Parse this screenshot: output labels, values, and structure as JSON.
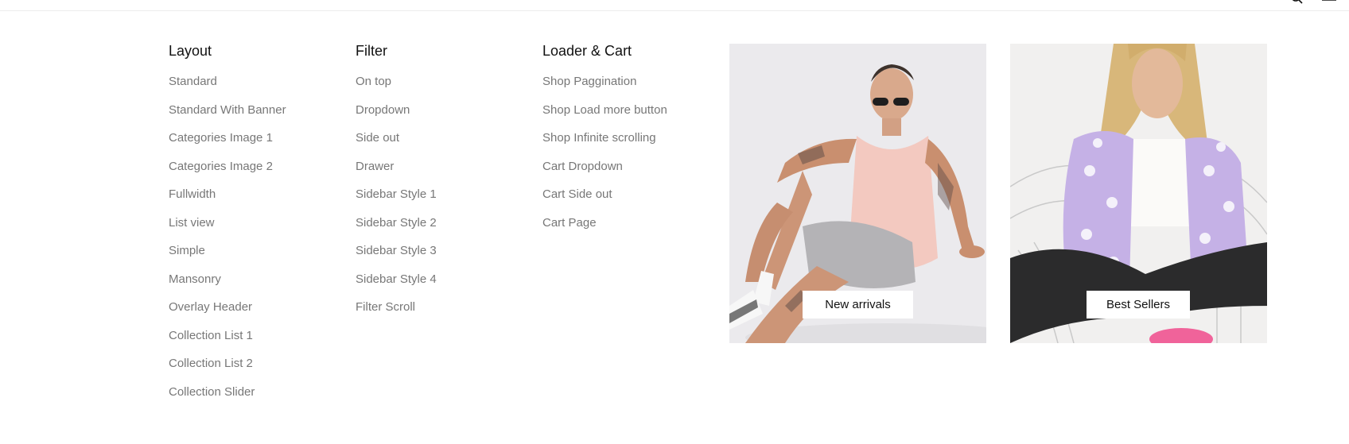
{
  "header": {
    "nav_stub": "",
    "icons": [
      "search-icon",
      "menu-icon"
    ]
  },
  "menu": {
    "layout": {
      "title": "Layout",
      "items": [
        "Standard",
        "Standard With Banner",
        "Categories Image 1",
        "Categories Image 2",
        "Fullwidth",
        "List view",
        "Simple",
        "Mansonry",
        "Overlay Header",
        "Collection List 1",
        "Collection List 2",
        "Collection Slider"
      ]
    },
    "filter": {
      "title": "Filter",
      "items": [
        "On top",
        "Dropdown",
        "Side out",
        "Drawer",
        "Sidebar Style 1",
        "Sidebar Style 2",
        "Sidebar Style 3",
        "Sidebar Style 4",
        "Filter Scroll"
      ]
    },
    "loader": {
      "title": "Loader & Cart",
      "items": [
        "Shop Paggination",
        "Shop Load more button",
        "Shop Infinite scrolling",
        "Cart Dropdown",
        "Cart Side out",
        "Cart Page"
      ]
    }
  },
  "promos": [
    {
      "label": "New arrivals",
      "image": "man-in-pink-tank-top-photo"
    },
    {
      "label": "Best Sellers",
      "image": "woman-in-lilac-cardigan-photo"
    }
  ],
  "colors": {
    "heading": "#111111",
    "link": "#777777",
    "background": "#ffffff"
  }
}
